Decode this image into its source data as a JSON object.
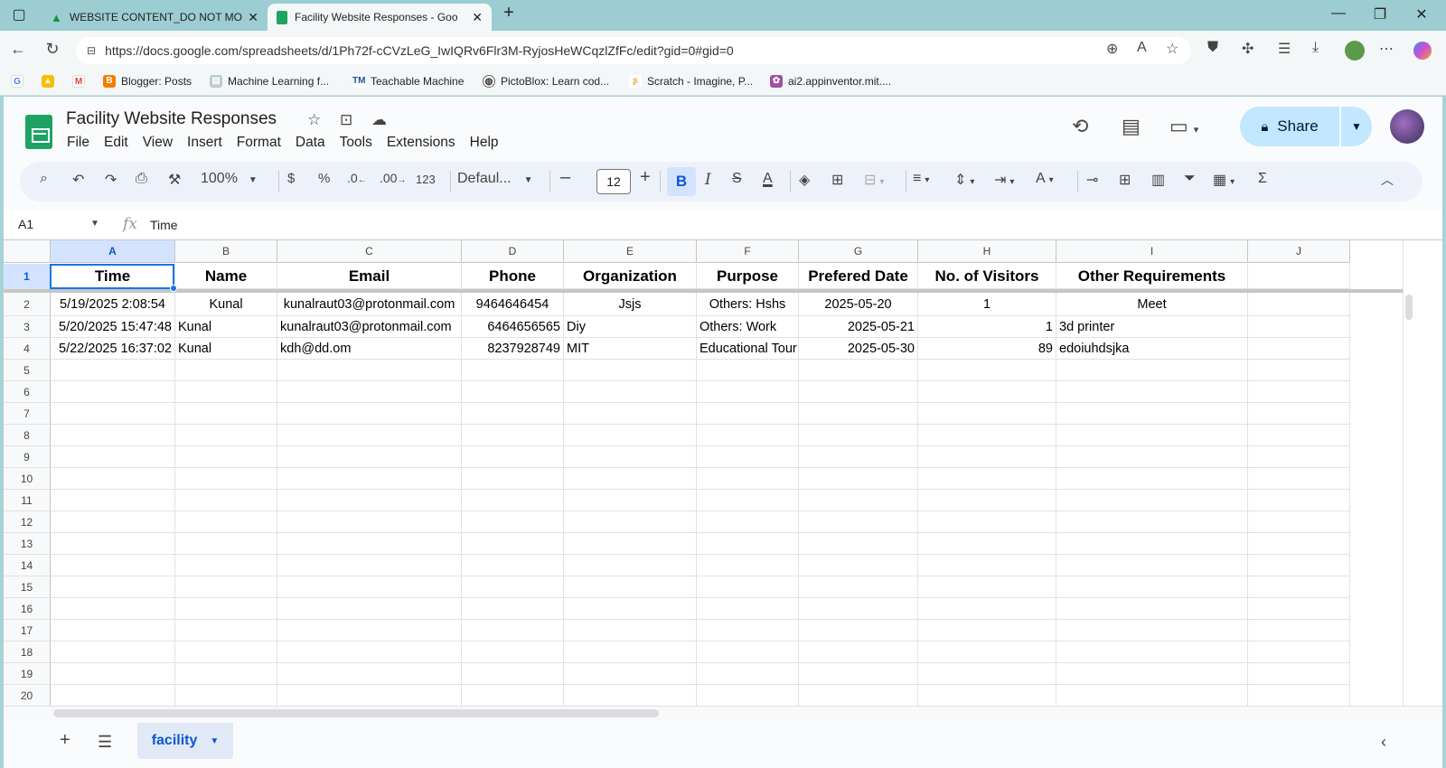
{
  "browser": {
    "tabs": [
      {
        "title": "WEBSITE CONTENT_DO NOT MO"
      },
      {
        "title": "Facility Website Responses - Goo"
      }
    ],
    "url": "https://docs.google.com/spreadsheets/d/1Ph72f-cCVzLeG_IwIQRv6Flr3M-RyjosHeWCqzlZfFc/edit?gid=0#gid=0",
    "bookmarks": [
      {
        "label": "Blogger: Posts"
      },
      {
        "label": "Machine Learning f..."
      },
      {
        "label": "Teachable Machine"
      },
      {
        "label": "PictoBlox: Learn cod..."
      },
      {
        "label": "Scratch - Imagine, P..."
      },
      {
        "label": "ai2.appinventor.mit...."
      }
    ]
  },
  "doc": {
    "title": "Facility Website Responses",
    "share_label": "Share",
    "menu": [
      "File",
      "Edit",
      "View",
      "Insert",
      "Format",
      "Data",
      "Tools",
      "Extensions",
      "Help"
    ]
  },
  "toolbar": {
    "zoom": "100%",
    "currency": "$",
    "percent": "%",
    "decrease_decimal": ".0",
    "increase_decimal": ".00",
    "number_format": "123",
    "font": "Defaul...",
    "font_size": "12",
    "bold": "B",
    "italic": "I"
  },
  "formula_bar": {
    "cell_ref": "A1",
    "content": "Time"
  },
  "columns": [
    "A",
    "B",
    "C",
    "D",
    "E",
    "F",
    "G",
    "H",
    "I",
    "J"
  ],
  "row_numbers": [
    "1",
    "2",
    "3",
    "4",
    "5",
    "6",
    "7",
    "8",
    "9",
    "10",
    "11",
    "12",
    "13",
    "14",
    "15",
    "16",
    "17",
    "18",
    "19",
    "20"
  ],
  "headers": [
    "Time",
    "Name",
    "Email",
    "Phone",
    "Organization",
    "Purpose",
    "Prefered Date",
    "No. of Visitors",
    "Other Requirements"
  ],
  "rows": [
    [
      "5/19/2025 2:08:54",
      "Kunal",
      "kunalraut03@protonmail.com",
      "9464646454",
      "Jsjs",
      "Others: Hshs",
      "2025-05-20",
      "1",
      "Meet"
    ],
    [
      "5/20/2025 15:47:48",
      "Kunal",
      "kunalraut03@protonmail.com",
      "6464656565",
      "Diy",
      "Others: Work",
      "2025-05-21",
      "1",
      "3d printer"
    ],
    [
      "5/22/2025 16:37:02",
      "Kunal",
      "kdh@dd.om",
      "8237928749",
      "MIT",
      "Educational Tour",
      "2025-05-30",
      "89",
      "edoiuhdsjka"
    ]
  ],
  "sheet": {
    "tab_name": "facility"
  },
  "colors": {
    "accent": "#1a73e8",
    "share_bg": "#c2e7ff",
    "logo": "#1ea362"
  }
}
